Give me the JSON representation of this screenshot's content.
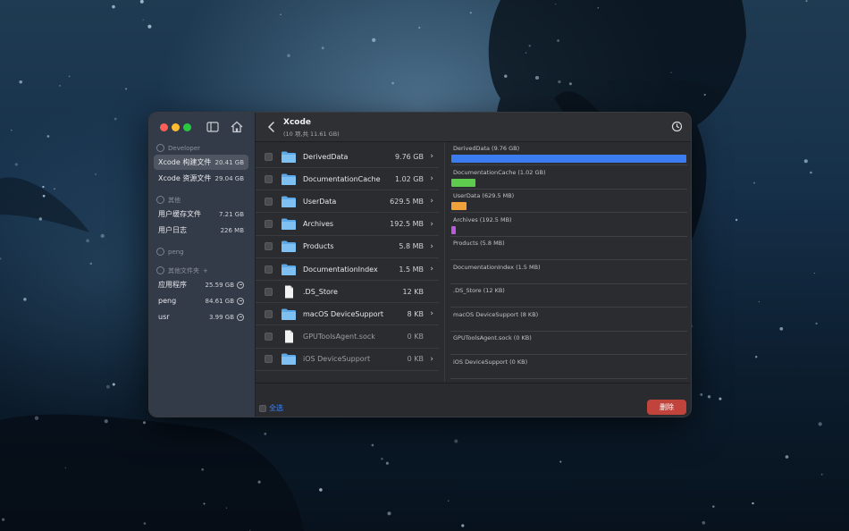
{
  "window": {
    "title": "Xcode",
    "subtitle": "(10 项,共 11.61 GB)"
  },
  "sidebar": {
    "sections": [
      {
        "header": "Developer",
        "items": [
          {
            "label": "Xcode 构建文件",
            "size": "20.41 GB",
            "selected": true
          },
          {
            "label": "Xcode 资源文件",
            "size": "29.04 GB",
            "selected": false
          }
        ]
      },
      {
        "header": "其他",
        "items": [
          {
            "label": "用户缓存文件",
            "size": "7.21 GB",
            "selected": false
          },
          {
            "label": "用户日志",
            "size": "226 MB",
            "selected": false
          }
        ]
      },
      {
        "header": "peng",
        "items": []
      },
      {
        "header": "其他文件夹",
        "header_action": "+",
        "items": [
          {
            "label": "应用程序",
            "size": "25.59 GB",
            "removable": true
          },
          {
            "label": "peng",
            "size": "84.61 GB",
            "removable": true
          },
          {
            "label": "usr",
            "size": "3.99 GB",
            "removable": true
          }
        ]
      }
    ]
  },
  "files": [
    {
      "name": "DerivedData",
      "size": "9.76 GB",
      "type": "folder",
      "dim": false,
      "has_chevron": true
    },
    {
      "name": "DocumentationCache",
      "size": "1.02 GB",
      "type": "folder",
      "dim": false,
      "has_chevron": true
    },
    {
      "name": "UserData",
      "size": "629.5 MB",
      "type": "folder",
      "dim": false,
      "has_chevron": true
    },
    {
      "name": "Archives",
      "size": "192.5 MB",
      "type": "folder",
      "dim": false,
      "has_chevron": true
    },
    {
      "name": "Products",
      "size": "5.8 MB",
      "type": "folder",
      "dim": false,
      "has_chevron": true
    },
    {
      "name": "DocumentationIndex",
      "size": "1.5 MB",
      "type": "folder",
      "dim": false,
      "has_chevron": true
    },
    {
      "name": ".DS_Store",
      "size": "12 KB",
      "type": "file",
      "dim": false,
      "has_chevron": false
    },
    {
      "name": "macOS DeviceSupport",
      "size": "8 KB",
      "type": "folder",
      "dim": false,
      "has_chevron": true
    },
    {
      "name": "GPUToolsAgent.sock",
      "size": "0 KB",
      "type": "file",
      "dim": true,
      "has_chevron": false
    },
    {
      "name": "iOS DeviceSupport",
      "size": "0 KB",
      "type": "folder",
      "dim": true,
      "has_chevron": true
    }
  ],
  "usage_chart": [
    {
      "label": "DerivedData (9.76 GB)",
      "fraction": 1.0,
      "color": "#3b7cf0"
    },
    {
      "label": "DocumentationCache (1.02 GB)",
      "fraction": 0.104,
      "color": "#5ecb4e"
    },
    {
      "label": "UserData (629.5 MB)",
      "fraction": 0.063,
      "color": "#f0a23a"
    },
    {
      "label": "Archives (192.5 MB)",
      "fraction": 0.019,
      "color": "#b85ad9"
    },
    {
      "label": "Products (5.8 MB)",
      "fraction": 0,
      "color": "#888888"
    },
    {
      "label": "DocumentationIndex (1.5 MB)",
      "fraction": 0,
      "color": "#888888"
    },
    {
      "label": ".DS_Store (12 KB)",
      "fraction": 0,
      "color": "#888888"
    },
    {
      "label": "macOS DeviceSupport (8 KB)",
      "fraction": 0,
      "color": "#888888"
    },
    {
      "label": "GPUToolsAgent.sock (0 KB)",
      "fraction": 0,
      "color": "#888888"
    },
    {
      "label": "iOS DeviceSupport (0 KB)",
      "fraction": 0,
      "color": "#888888"
    }
  ],
  "footer": {
    "select_all_label": "全选",
    "delete_label": "删除"
  },
  "icons": {
    "sidebar_toggle": "sidebar-toggle-icon",
    "home": "home-icon",
    "back": "chevron-left-icon",
    "history": "clock-icon"
  }
}
